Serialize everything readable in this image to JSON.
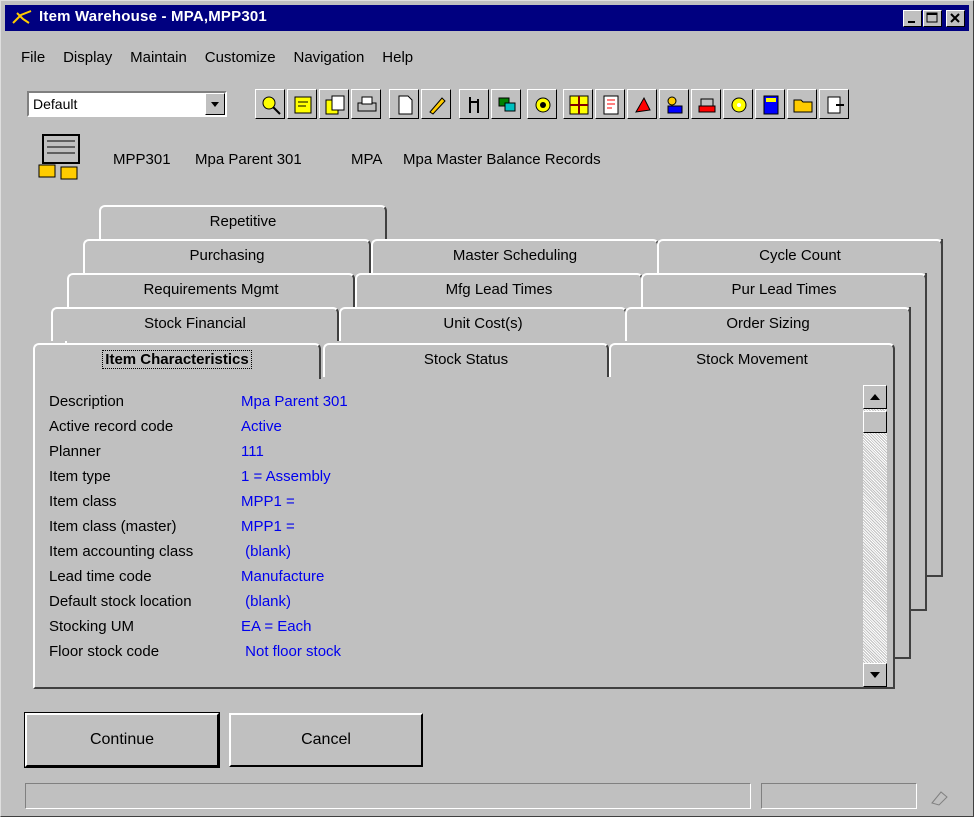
{
  "window": {
    "title": "Item Warehouse - MPA,MPP301"
  },
  "menu": [
    {
      "label": "File"
    },
    {
      "label": "Display"
    },
    {
      "label": "Maintain"
    },
    {
      "label": "Customize"
    },
    {
      "label": "Navigation"
    },
    {
      "label": "Help"
    }
  ],
  "toolbar": {
    "view_select": "Default"
  },
  "header": {
    "item_code": "MPP301",
    "item_name": "Mpa Parent 301",
    "warehouse_code": "MPA",
    "warehouse_name": "Mpa Master Balance Records"
  },
  "tabs": {
    "row5": [
      "Repetitive"
    ],
    "row4": [
      "Purchasing",
      "Master Scheduling",
      "Cycle Count"
    ],
    "row3": [
      "Requirements Mgmt",
      "Mfg Lead Times",
      "Pur Lead Times"
    ],
    "row2": [
      "Stock Financial",
      "Unit Cost(s)",
      "Order Sizing"
    ],
    "row1": [
      "Item Characteristics",
      "Stock Status",
      "Stock Movement"
    ]
  },
  "fields": [
    {
      "label": "Description",
      "value": "Mpa Parent 301"
    },
    {
      "label": "Active record code",
      "value": "Active"
    },
    {
      "label": "Planner",
      "value": "111"
    },
    {
      "label": "Item type",
      "value": "1 = Assembly"
    },
    {
      "label": "Item class",
      "value": "MPP1 ="
    },
    {
      "label": "Item class (master)",
      "value": "MPP1 ="
    },
    {
      "label": "Item accounting class",
      "value": " (blank)"
    },
    {
      "label": "Lead time code",
      "value": "Manufacture"
    },
    {
      "label": "Default stock location",
      "value": " (blank)"
    },
    {
      "label": "Stocking UM",
      "value": "EA = Each"
    },
    {
      "label": "Floor stock code",
      "value": " Not floor stock"
    }
  ],
  "buttons": {
    "continue": "Continue",
    "cancel": "Cancel"
  },
  "colors": {
    "title_bar": "#000080",
    "value_text": "#0000ee",
    "face": "#c0c0c0"
  }
}
